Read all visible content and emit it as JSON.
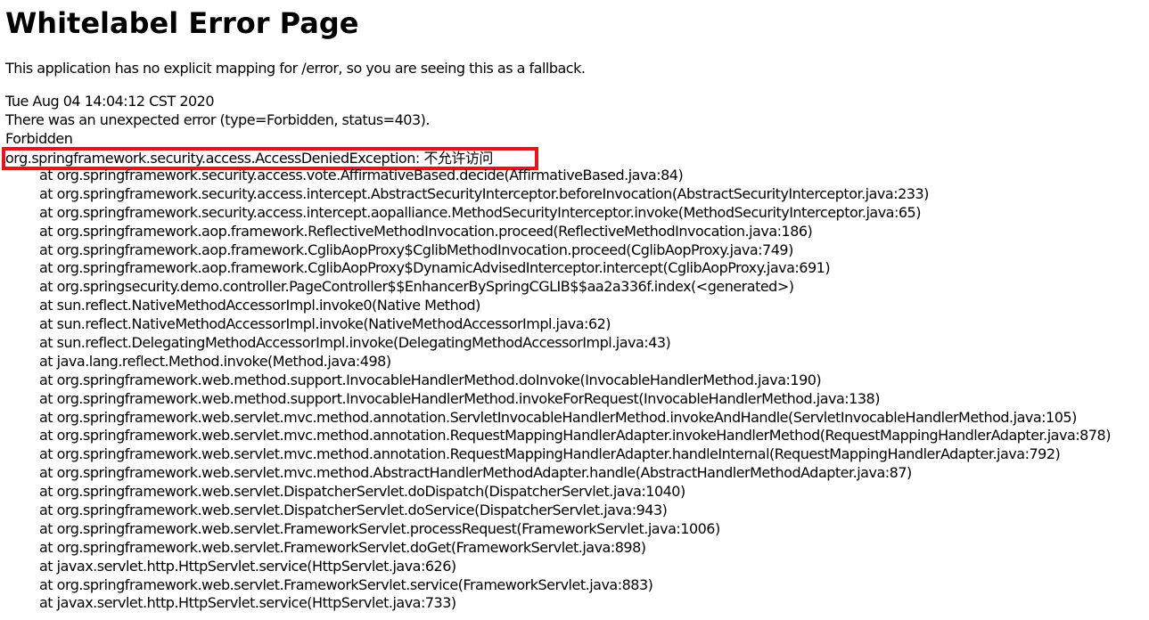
{
  "title": "Whitelabel Error Page",
  "fallback_message": "This application has no explicit mapping for /error, so you are seeing this as a fallback.",
  "timestamp": "Tue Aug 04 14:04:12 CST 2020",
  "error_summary": "There was an unexpected error (type=Forbidden, status=403).",
  "error_reason": "Forbidden",
  "exception": "org.springframework.security.access.AccessDeniedException: 不允许访问",
  "highlight_color": "#e8141b",
  "stack_trace": [
    "at org.springframework.security.access.vote.AffirmativeBased.decide(AffirmativeBased.java:84)",
    "at org.springframework.security.access.intercept.AbstractSecurityInterceptor.beforeInvocation(AbstractSecurityInterceptor.java:233)",
    "at org.springframework.security.access.intercept.aopalliance.MethodSecurityInterceptor.invoke(MethodSecurityInterceptor.java:65)",
    "at org.springframework.aop.framework.ReflectiveMethodInvocation.proceed(ReflectiveMethodInvocation.java:186)",
    "at org.springframework.aop.framework.CglibAopProxy$CglibMethodInvocation.proceed(CglibAopProxy.java:749)",
    "at org.springframework.aop.framework.CglibAopProxy$DynamicAdvisedInterceptor.intercept(CglibAopProxy.java:691)",
    "at org.springsecurity.demo.controller.PageController$$EnhancerBySpringCGLIB$$aa2a336f.index(<generated>)",
    "at sun.reflect.NativeMethodAccessorImpl.invoke0(Native Method)",
    "at sun.reflect.NativeMethodAccessorImpl.invoke(NativeMethodAccessorImpl.java:62)",
    "at sun.reflect.DelegatingMethodAccessorImpl.invoke(DelegatingMethodAccessorImpl.java:43)",
    "at java.lang.reflect.Method.invoke(Method.java:498)",
    "at org.springframework.web.method.support.InvocableHandlerMethod.doInvoke(InvocableHandlerMethod.java:190)",
    "at org.springframework.web.method.support.InvocableHandlerMethod.invokeForRequest(InvocableHandlerMethod.java:138)",
    "at org.springframework.web.servlet.mvc.method.annotation.ServletInvocableHandlerMethod.invokeAndHandle(ServletInvocableHandlerMethod.java:105)",
    "at org.springframework.web.servlet.mvc.method.annotation.RequestMappingHandlerAdapter.invokeHandlerMethod(RequestMappingHandlerAdapter.java:878)",
    "at org.springframework.web.servlet.mvc.method.annotation.RequestMappingHandlerAdapter.handleInternal(RequestMappingHandlerAdapter.java:792)",
    "at org.springframework.web.servlet.mvc.method.AbstractHandlerMethodAdapter.handle(AbstractHandlerMethodAdapter.java:87)",
    "at org.springframework.web.servlet.DispatcherServlet.doDispatch(DispatcherServlet.java:1040)",
    "at org.springframework.web.servlet.DispatcherServlet.doService(DispatcherServlet.java:943)",
    "at org.springframework.web.servlet.FrameworkServlet.processRequest(FrameworkServlet.java:1006)",
    "at org.springframework.web.servlet.FrameworkServlet.doGet(FrameworkServlet.java:898)",
    "at javax.servlet.http.HttpServlet.service(HttpServlet.java:626)",
    "at org.springframework.web.servlet.FrameworkServlet.service(FrameworkServlet.java:883)",
    "at javax.servlet.http.HttpServlet.service(HttpServlet.java:733)"
  ]
}
